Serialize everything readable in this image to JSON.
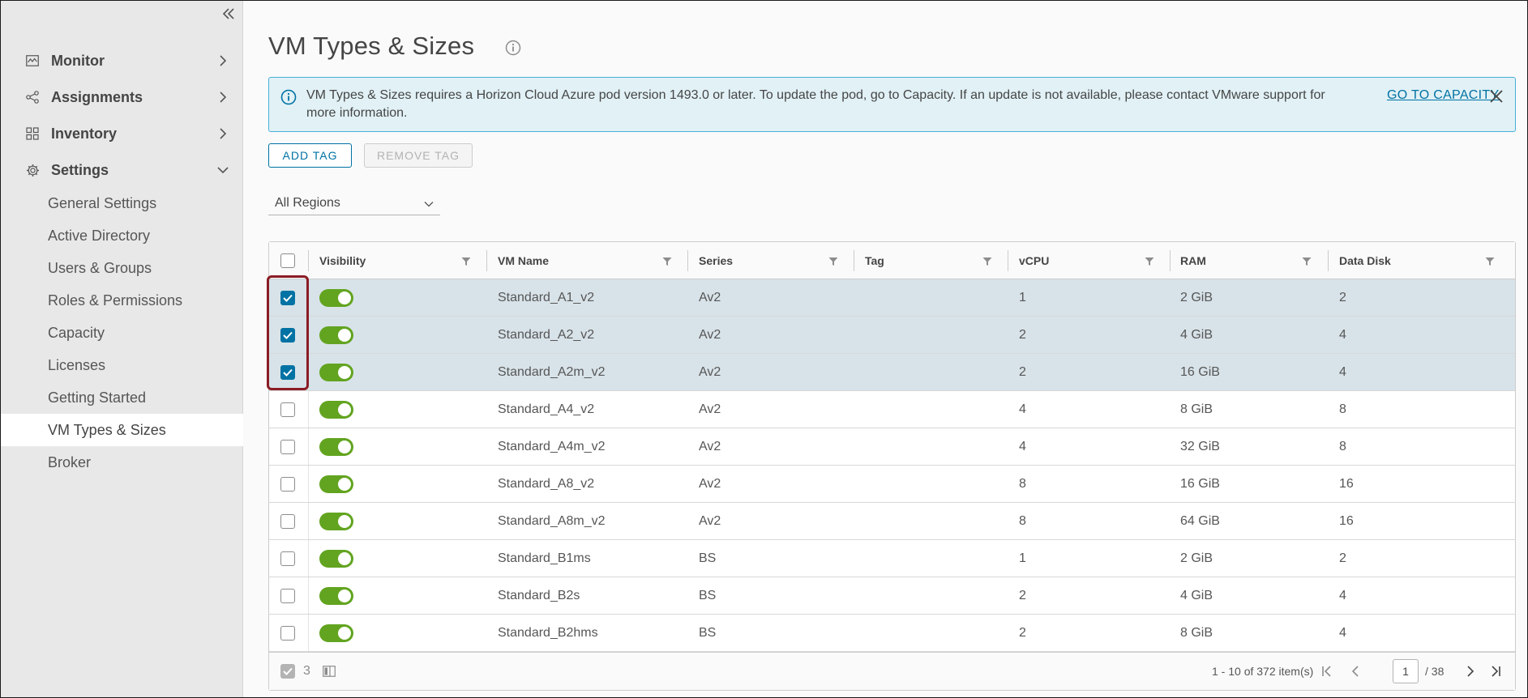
{
  "sidebar": {
    "groups": [
      {
        "label": "Monitor",
        "icon": "monitor-icon",
        "expanded": false
      },
      {
        "label": "Assignments",
        "icon": "share-icon",
        "expanded": false
      },
      {
        "label": "Inventory",
        "icon": "grid-icon",
        "expanded": false
      },
      {
        "label": "Settings",
        "icon": "gear-icon",
        "expanded": true
      }
    ],
    "settings_items": [
      {
        "label": "General Settings"
      },
      {
        "label": "Active Directory"
      },
      {
        "label": "Users & Groups"
      },
      {
        "label": "Roles & Permissions"
      },
      {
        "label": "Capacity"
      },
      {
        "label": "Licenses"
      },
      {
        "label": "Getting Started"
      },
      {
        "label": "VM Types & Sizes",
        "active": true
      },
      {
        "label": "Broker"
      }
    ]
  },
  "page": {
    "title": "VM Types & Sizes"
  },
  "alert": {
    "text": "VM Types & Sizes requires a Horizon Cloud Azure pod version 1493.0 or later. To update the pod, go to Capacity. If an update is not available, please contact VMware support for more information.",
    "link": "GO TO CAPACITY"
  },
  "toolbar": {
    "add_tag": "ADD TAG",
    "remove_tag": "REMOVE TAG"
  },
  "region_filter": {
    "value": "All Regions"
  },
  "table": {
    "columns": [
      "Visibility",
      "VM Name",
      "Series",
      "Tag",
      "vCPU",
      "RAM",
      "Data Disk"
    ],
    "rows": [
      {
        "selected": true,
        "visible": true,
        "name": "Standard_A1_v2",
        "series": "Av2",
        "tag": "",
        "vcpu": "1",
        "ram": "2 GiB",
        "disk": "2"
      },
      {
        "selected": true,
        "visible": true,
        "name": "Standard_A2_v2",
        "series": "Av2",
        "tag": "",
        "vcpu": "2",
        "ram": "4 GiB",
        "disk": "4"
      },
      {
        "selected": true,
        "visible": true,
        "name": "Standard_A2m_v2",
        "series": "Av2",
        "tag": "",
        "vcpu": "2",
        "ram": "16 GiB",
        "disk": "4"
      },
      {
        "selected": false,
        "visible": true,
        "name": "Standard_A4_v2",
        "series": "Av2",
        "tag": "",
        "vcpu": "4",
        "ram": "8 GiB",
        "disk": "8"
      },
      {
        "selected": false,
        "visible": true,
        "name": "Standard_A4m_v2",
        "series": "Av2",
        "tag": "",
        "vcpu": "4",
        "ram": "32 GiB",
        "disk": "8"
      },
      {
        "selected": false,
        "visible": true,
        "name": "Standard_A8_v2",
        "series": "Av2",
        "tag": "",
        "vcpu": "8",
        "ram": "16 GiB",
        "disk": "16"
      },
      {
        "selected": false,
        "visible": true,
        "name": "Standard_A8m_v2",
        "series": "Av2",
        "tag": "",
        "vcpu": "8",
        "ram": "64 GiB",
        "disk": "16"
      },
      {
        "selected": false,
        "visible": true,
        "name": "Standard_B1ms",
        "series": "BS",
        "tag": "",
        "vcpu": "1",
        "ram": "2 GiB",
        "disk": "2"
      },
      {
        "selected": false,
        "visible": true,
        "name": "Standard_B2s",
        "series": "BS",
        "tag": "",
        "vcpu": "2",
        "ram": "4 GiB",
        "disk": "4"
      },
      {
        "selected": false,
        "visible": true,
        "name": "Standard_B2hms",
        "series": "BS",
        "tag": "",
        "vcpu": "2",
        "ram": "8 GiB",
        "disk": "4"
      }
    ]
  },
  "footer": {
    "selected_count": "3",
    "range": "1 - 10 of 372 item(s)",
    "current_page": "1",
    "total_pages": "/ 38"
  },
  "colors": {
    "accent": "#0072a3",
    "toggle_on": "#62a420",
    "selected_row": "#d8e3e9",
    "alert_bg": "#e1f1f6",
    "highlight": "#8b1c24"
  }
}
